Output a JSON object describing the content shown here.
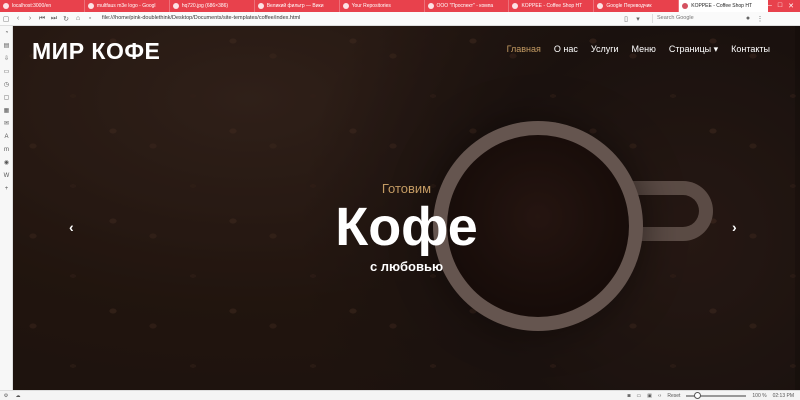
{
  "tabs": [
    {
      "label": "localhost:3000/en"
    },
    {
      "label": "multfaus m3e logo - Googl"
    },
    {
      "label": "hq720.jpg (686×386)"
    },
    {
      "label": "Великий фильтр — Вики"
    },
    {
      "label": "Your Repositories"
    },
    {
      "label": "ООО \"Проспект\" - компа"
    },
    {
      "label": "KOPPEE - Coffee Shop HT"
    },
    {
      "label": "Google Переводчик"
    },
    {
      "label": "KOPPEE - Coffee Shop HT"
    }
  ],
  "address": {
    "url": "file:///home/pink-doublethink/Desktop/Documents/site-templates/coffee/index.html",
    "search_placeholder": "Search Google"
  },
  "site": {
    "brand": "МИР КОФЕ",
    "nav": [
      "Главная",
      "О нас",
      "Услуги",
      "Меню",
      "Страницы ▾",
      "Контакты"
    ],
    "hero": {
      "small": "Готовим",
      "big": "Кофе",
      "sub": "с любовью"
    }
  },
  "status": {
    "reset": "Reset",
    "zoom": "100 %",
    "time": "02:13 PM"
  },
  "colors": {
    "accent": "#c49b63",
    "tabbar": "#e8414c"
  }
}
